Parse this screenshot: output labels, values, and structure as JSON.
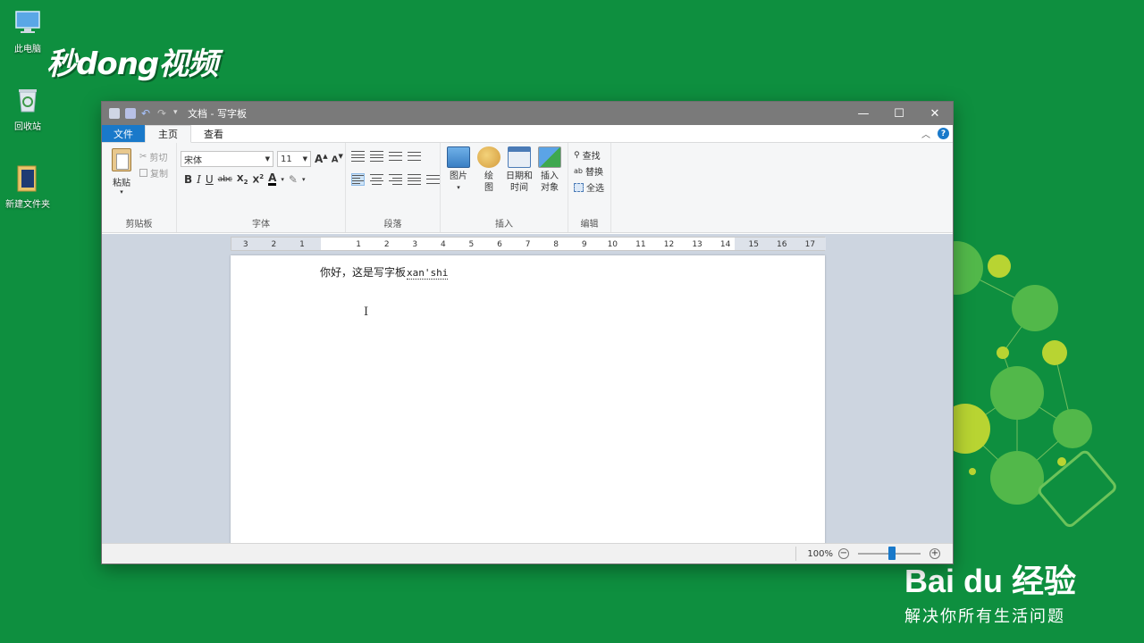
{
  "desktop": {
    "icons": [
      {
        "label": "此电脑"
      },
      {
        "label": "回收站"
      },
      {
        "label": "新建文件夹"
      }
    ],
    "brand_logo": "秒dong视频"
  },
  "watermark": {
    "brand": "Bai du 经验",
    "slogan": "解决你所有生活问题"
  },
  "window": {
    "title": "文档 - 写字板",
    "controls": {
      "minimize": "—",
      "maximize": "☐",
      "close": "✕"
    }
  },
  "ribbon": {
    "tabs": [
      {
        "label": "文件"
      },
      {
        "label": "主页"
      },
      {
        "label": "查看"
      }
    ],
    "help": "?",
    "clipboard": {
      "paste": "粘贴",
      "cut": "剪切",
      "copy": "复制",
      "group_label": "剪贴板"
    },
    "font": {
      "family": "宋体",
      "size": "11",
      "group_label": "字体"
    },
    "paragraph": {
      "group_label": "段落"
    },
    "insert": {
      "picture": "图片",
      "paint": "绘图",
      "datetime": "日期和时间",
      "object": "插入对象",
      "group_label": "插入"
    },
    "edit": {
      "find": "查找",
      "replace": "替换",
      "select_all": "全选",
      "group_label": "编辑"
    }
  },
  "ruler": {
    "ticks": [
      "3",
      "2",
      "1",
      "",
      "1",
      "2",
      "3",
      "4",
      "5",
      "6",
      "7",
      "8",
      "9",
      "10",
      "11",
      "12",
      "13",
      "14",
      "15",
      "16",
      "17"
    ]
  },
  "document": {
    "text": "你好，这是写字板",
    "ime_composition": "xan'shi"
  },
  "status": {
    "zoom": "100%",
    "zoom_level_percent": 100
  },
  "colors": {
    "desktop_bg": "#0e8f3f",
    "titlebar": "#7a7a7a",
    "file_tab": "#1979ca",
    "ribbon_bg": "#f5f6f7",
    "doc_bg": "#cdd5e0"
  }
}
